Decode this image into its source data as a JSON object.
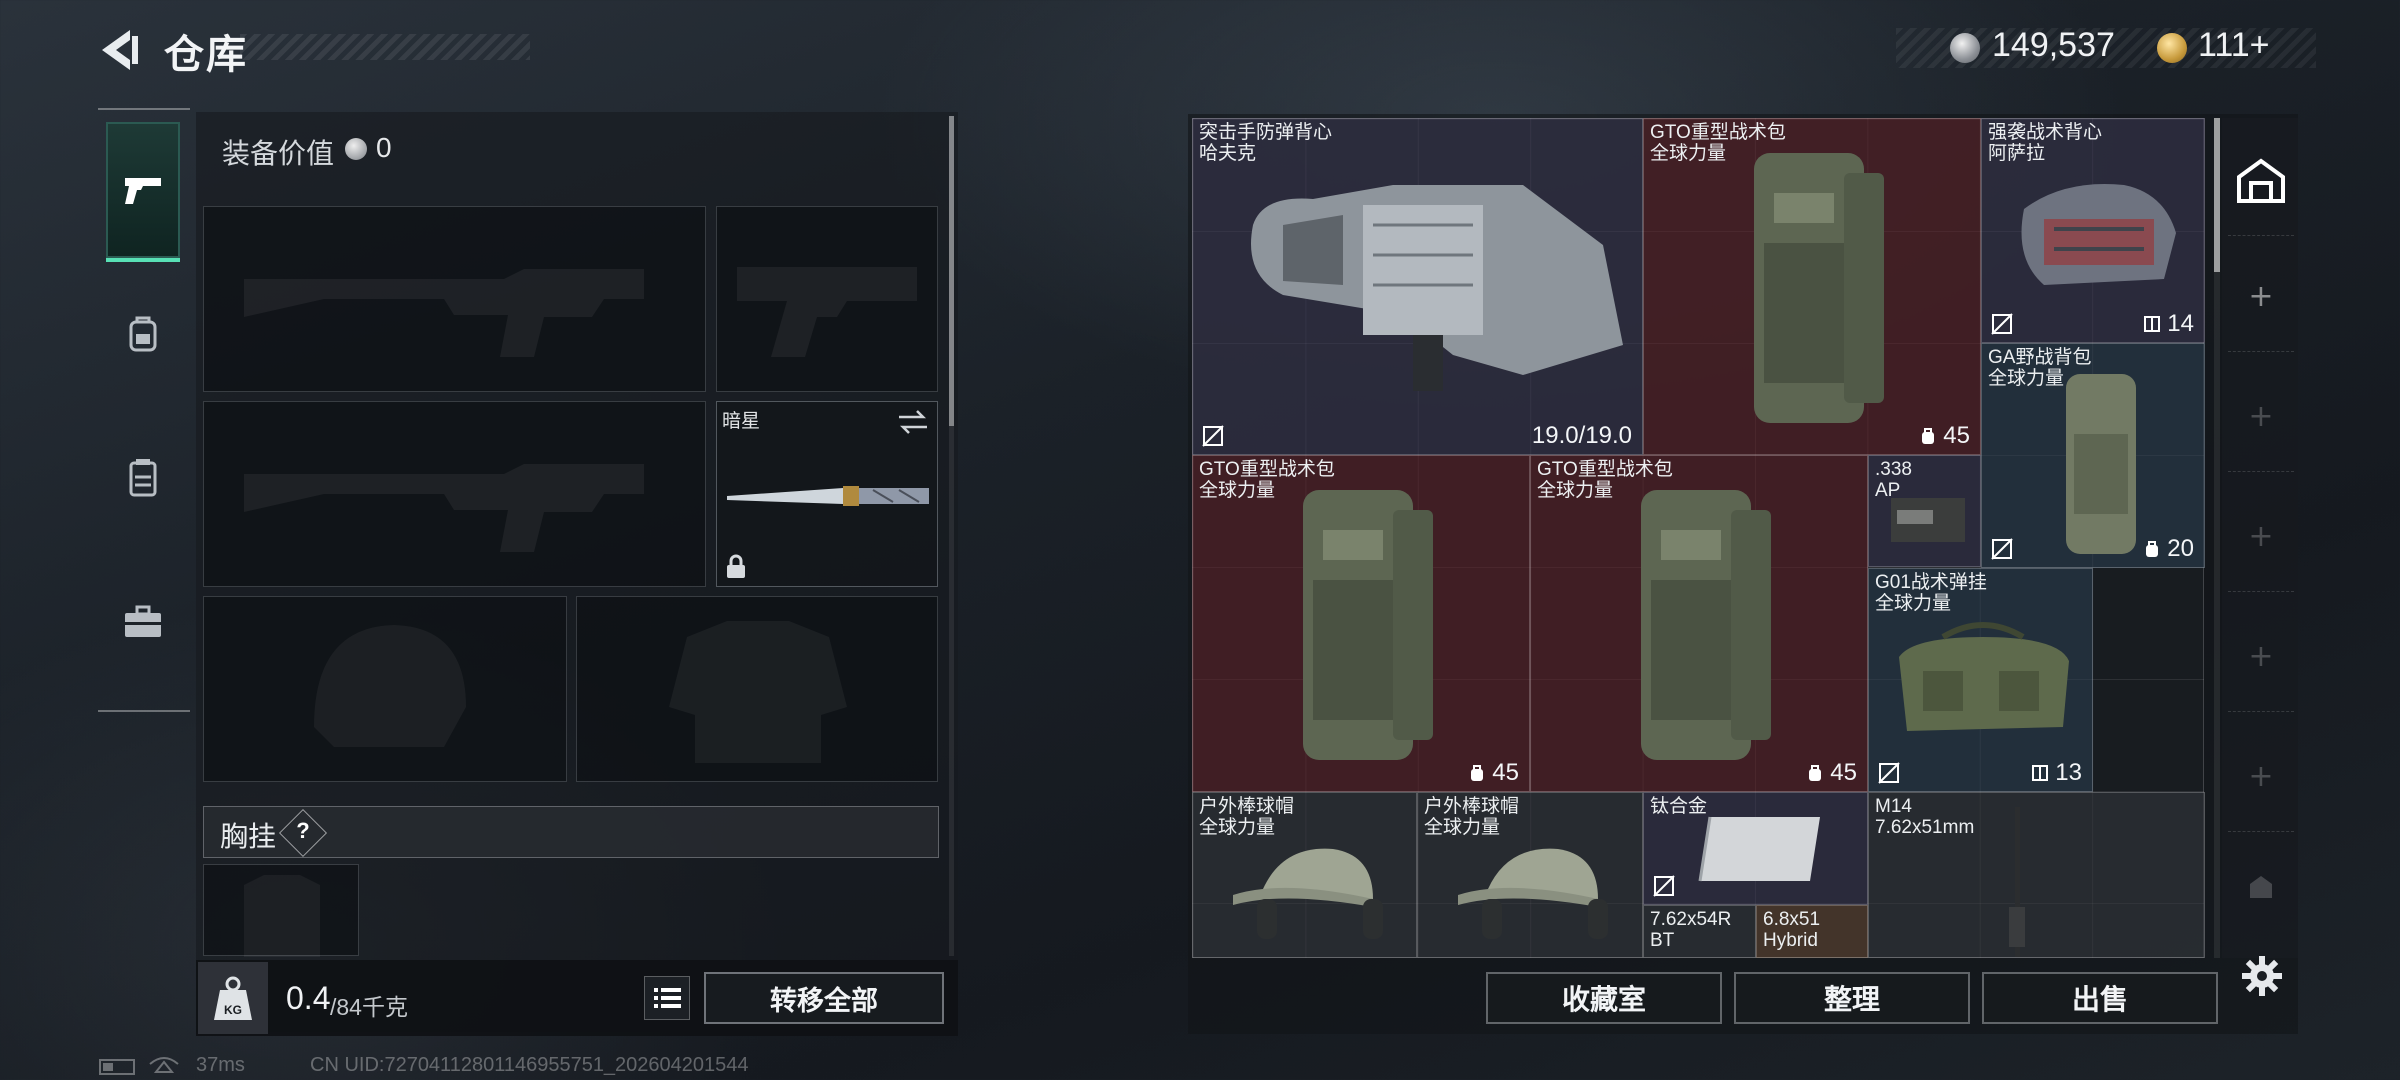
{
  "header": {
    "title": "仓库",
    "money": "149,537",
    "premium": "111+"
  },
  "left_nav": {
    "items": [
      {
        "icon": "pistol-icon",
        "active": true
      },
      {
        "icon": "backpack-icon",
        "active": false
      },
      {
        "icon": "vest-icon",
        "active": false
      },
      {
        "icon": "toolbox-icon",
        "active": false
      }
    ]
  },
  "loadout": {
    "equip_value_label": "装备价值",
    "equip_value": "0",
    "knife_name": "暗星",
    "chest_rig_label": "胸挂",
    "chest_rig_help": "?",
    "weight_value": "0.4",
    "weight_max": "/84千克",
    "transfer_all_label": "转移全部"
  },
  "stash": {
    "items": [
      {
        "name": "突击手防弹背心",
        "sub": "哈夫克",
        "stat": "19.0/19.0",
        "rarity": "purple"
      },
      {
        "name": "GTO重型战术包",
        "sub": "全球力量",
        "stat": "45",
        "rarity": "red"
      },
      {
        "name": "强袭战术背心",
        "sub": "阿萨拉",
        "stat": "14",
        "rarity": "purple"
      },
      {
        "name": "GA野战背包",
        "sub": "全球力量",
        "stat": "20",
        "rarity": "blue"
      },
      {
        "name": "GTO重型战术包",
        "sub": "全球力量",
        "stat": "45",
        "rarity": "red"
      },
      {
        "name": "GTO重型战术包",
        "sub": "全球力量",
        "stat": "45",
        "rarity": "red"
      },
      {
        "name": ".338",
        "sub": "AP",
        "stat": "",
        "rarity": "purple"
      },
      {
        "name": "G01战术弹挂",
        "sub": "全球力量",
        "stat": "13",
        "rarity": "blue"
      },
      {
        "name": "户外棒球帽",
        "sub": "全球力量",
        "stat": "",
        "rarity": "gray"
      },
      {
        "name": "户外棒球帽",
        "sub": "全球力量",
        "stat": "",
        "rarity": "gray"
      },
      {
        "name": "钛合金",
        "sub": "",
        "stat": "",
        "rarity": "purple"
      },
      {
        "name": "M14",
        "sub": "7.62x51mm",
        "stat": "",
        "rarity": "gray"
      },
      {
        "name": "7.62x54R",
        "sub": "BT",
        "stat": "",
        "rarity": "gray"
      },
      {
        "name": "6.8x51",
        "sub": "Hybrid",
        "stat": "",
        "rarity": "gray"
      }
    ],
    "buttons": {
      "collection": "收藏室",
      "organize": "整理",
      "sell": "出售"
    }
  },
  "status": {
    "latency": "37ms",
    "uid": "CN UID:72704112801146955751_202604201544"
  },
  "colors": {
    "accent": "#58e0b5",
    "rarity_red": "#622028",
    "rarity_purple": "#3a3652",
    "rarity_blue": "#2c4052",
    "rarity_gray": "#34383e"
  }
}
